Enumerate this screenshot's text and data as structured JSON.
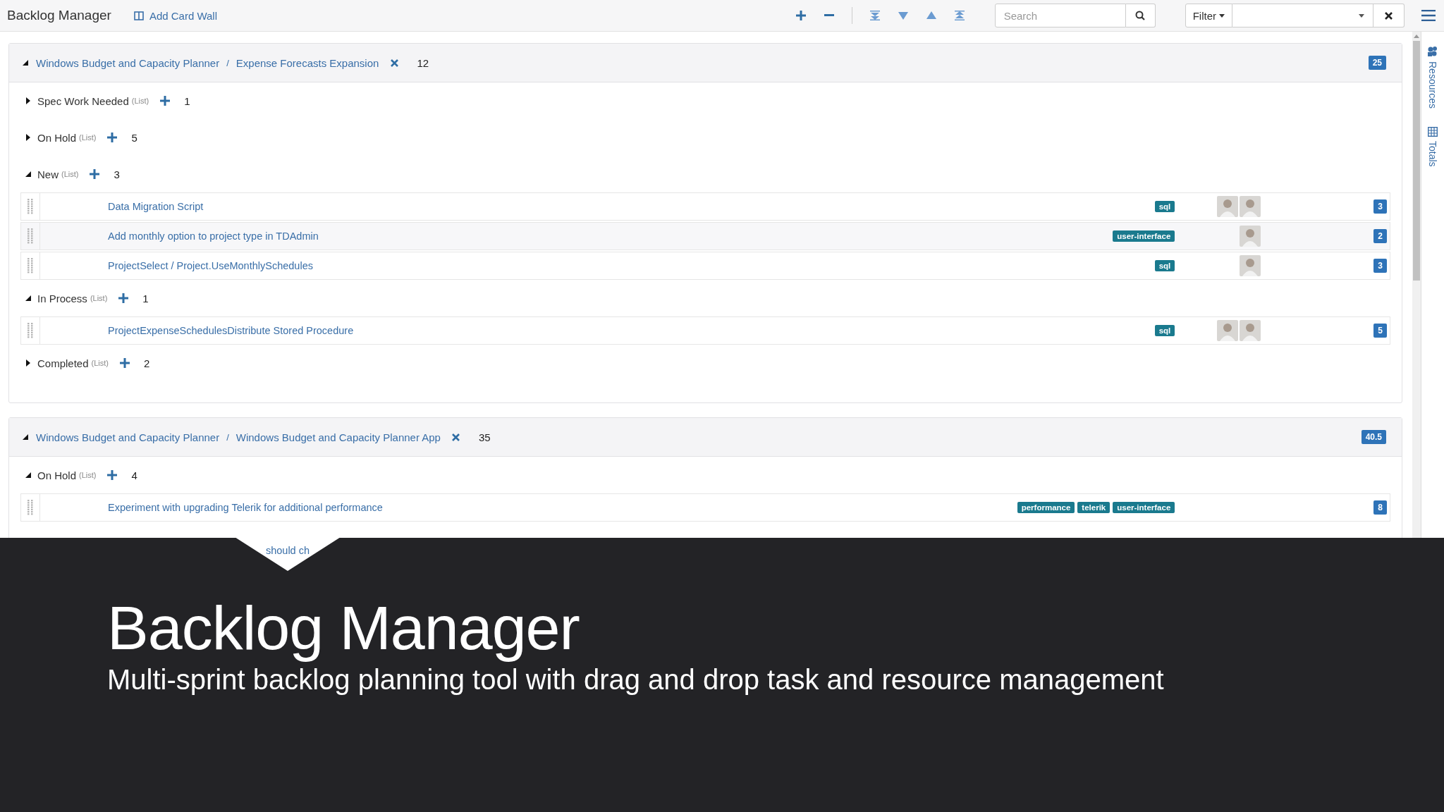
{
  "app": {
    "title": "Backlog Manager",
    "add_card_wall": "Add Card Wall"
  },
  "toolbar": {
    "search": {
      "placeholder": "Search"
    },
    "filter": "Filter"
  },
  "side_panel": [
    "Resources",
    "Totals"
  ],
  "sections": [
    {
      "project": "Windows Budget and Capacity Planner",
      "separator": "/",
      "sprint": "Expense Forecasts Expansion",
      "count": "12",
      "points": "25",
      "expanded": true,
      "lists": [
        {
          "name": "Spec Work Needed",
          "tag": "(List)",
          "count": "1",
          "expanded": false
        },
        {
          "name": "On Hold",
          "tag": "(List)",
          "count": "5",
          "expanded": false
        },
        {
          "name": "New",
          "tag": "(List)",
          "count": "3",
          "expanded": true,
          "items": [
            {
              "title": "Data Migration Script",
              "tags": [
                "sql"
              ],
              "assignees": [
                {
                  "kind": "photo"
                },
                {
                  "kind": "photo"
                }
              ],
              "points": "3",
              "shaded": false
            },
            {
              "title": "Add monthly option to project type in TDAdmin",
              "tags": [
                "user-interface"
              ],
              "assignees": [
                {
                  "kind": "photo"
                }
              ],
              "points": "2",
              "shaded": true
            },
            {
              "title": "ProjectSelect / Project.UseMonthlySchedules",
              "tags": [
                "sql"
              ],
              "assignees": [
                {
                  "kind": "photo"
                }
              ],
              "points": "3",
              "shaded": false
            }
          ]
        },
        {
          "name": "In Process",
          "tag": "(List)",
          "count": "1",
          "expanded": true,
          "items": [
            {
              "title": "ProjectExpenseSchedulesDistribute Stored Procedure",
              "tags": [
                "sql"
              ],
              "assignees": [
                {
                  "kind": "photo"
                },
                {
                  "kind": "photo"
                }
              ],
              "points": "5",
              "shaded": false
            }
          ]
        },
        {
          "name": "Completed",
          "tag": "(List)",
          "count": "2",
          "expanded": false
        }
      ]
    },
    {
      "project": "Windows Budget and Capacity Planner",
      "separator": "/",
      "sprint": "Windows Budget and Capacity Planner App",
      "count": "35",
      "points": "40.5",
      "expanded": true,
      "lists": [
        {
          "name": "On Hold",
          "tag": "(List)",
          "count": "4",
          "expanded": true,
          "items": [
            {
              "title": "Experiment with upgrading Telerik for additional performance",
              "tags": [
                "performance",
                "telerik",
                "user-interface"
              ],
              "points": "8",
              "shaded": false
            }
          ]
        }
      ]
    }
  ],
  "banner": {
    "title": "Backlog Manager",
    "subtitle": "Multi-sprint backlog planning tool with drag and drop task and resource management",
    "peek_text": "should ch"
  }
}
